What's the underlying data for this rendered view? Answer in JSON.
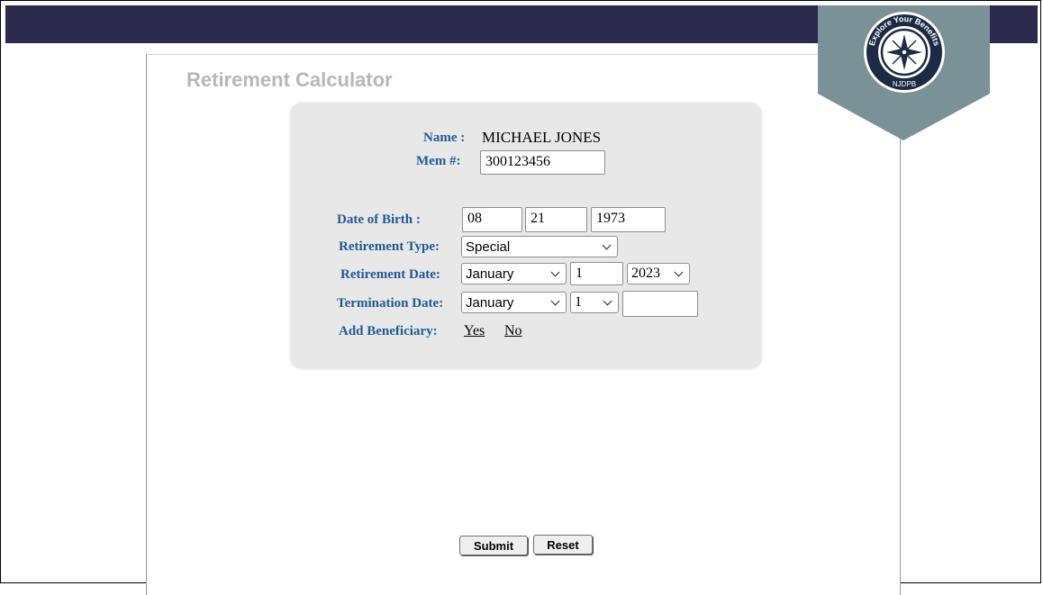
{
  "header": {
    "title": "Retirement Calculator"
  },
  "badge": {
    "text_top": "Explore Your Benefits",
    "text_bottom": "NJDPB",
    "icon": "compass-icon",
    "color": "#7a9198"
  },
  "member": {
    "name_label": "Name :",
    "name_value": "MICHAEL JONES",
    "mem_label": "Mem #:",
    "mem_value": "300123456"
  },
  "form": {
    "dob_label": "Date of Birth :",
    "dob_month": "08",
    "dob_day": "21",
    "dob_year": "1973",
    "ret_type_label": "Retirement Type:",
    "ret_type_value": "Special",
    "ret_date_label": "Retirement Date:",
    "ret_date_month": "January",
    "ret_date_day": "1",
    "ret_date_year": "2023",
    "term_date_label": "Termination Date:",
    "term_date_month": "January",
    "term_date_day": "1",
    "term_date_year": "",
    "beneficiary_label": "Add Beneficiary:",
    "beneficiary_yes": "Yes",
    "beneficiary_no": "No"
  },
  "actions": {
    "submit_label": "Submit",
    "reset_label": "Reset"
  },
  "colors": {
    "topbar": "#2b2a4c",
    "label": "#1f5a96",
    "panel": "#e8e8e8"
  }
}
